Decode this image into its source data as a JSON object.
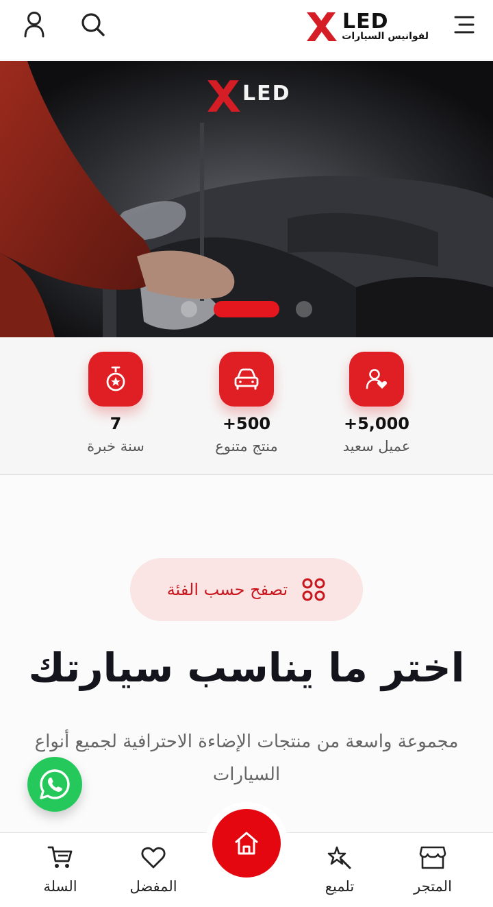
{
  "header": {
    "logo_brand": "LED",
    "logo_subtitle": "لفوانيس السيارات",
    "logo_mark": "X",
    "icons": {
      "menu": "menu-icon",
      "search": "search-icon",
      "account": "user-icon"
    }
  },
  "hero": {
    "logo_brand": "LED",
    "slides_count": 3,
    "active_slide": 2
  },
  "stats": [
    {
      "icon": "user-heart-icon",
      "value": "+5,000",
      "label": "عميل سعيد"
    },
    {
      "icon": "car-icon",
      "value": "+500",
      "label": "منتج متنوع"
    },
    {
      "icon": "medal-icon",
      "value": "7",
      "label": "سنة خبرة"
    }
  ],
  "category": {
    "pill_label": "تصفح حسب الفئة",
    "headline": "اختر ما يناسب سيارتك",
    "description": "مجموعة واسعة من منتجات الإضاءة الاحترافية لجميع أنواع السيارات"
  },
  "bottom_nav": {
    "store": "المتجر",
    "polish": "تلميع",
    "home": "home-icon",
    "favorites": "المفضل",
    "cart": "السلة"
  },
  "colors": {
    "accent": "#e4070f",
    "pill_bg": "#fbe4e4",
    "whatsapp": "#25c95b"
  }
}
